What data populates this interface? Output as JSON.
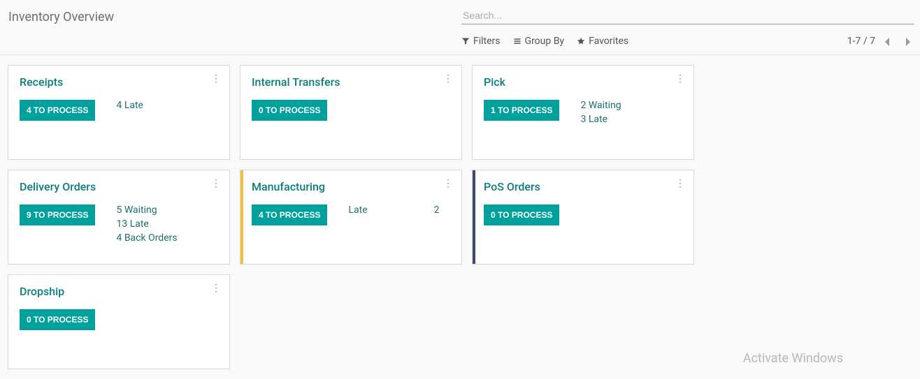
{
  "page": {
    "title": "Inventory Overview"
  },
  "search": {
    "placeholder": "Search..."
  },
  "toolbar": {
    "filters": "Filters",
    "groupby": "Group By",
    "favorites": "Favorites",
    "pager": "1-7 / 7"
  },
  "cards": [
    {
      "title": "Receipts",
      "button": "4 TO PROCESS",
      "statuses": [
        "4 Late"
      ],
      "accent": ""
    },
    {
      "title": "Internal Transfers",
      "button": "0 TO PROCESS",
      "statuses": [],
      "accent": ""
    },
    {
      "title": "Pick",
      "button": "1 TO PROCESS",
      "statuses": [
        "2 Waiting",
        "3 Late"
      ],
      "accent": ""
    },
    {
      "title": "Delivery Orders",
      "button": "9 TO PROCESS",
      "statuses": [
        "5 Waiting",
        "13 Late",
        "4 Back Orders"
      ],
      "accent": ""
    },
    {
      "title": "Manufacturing",
      "button": "4 TO PROCESS",
      "split": {
        "label": "Late",
        "count": "2"
      },
      "accent": "accent-yellow"
    },
    {
      "title": "PoS Orders",
      "button": "0 TO PROCESS",
      "statuses": [],
      "accent": "accent-navy"
    },
    {
      "title": "Dropship",
      "button": "0 TO PROCESS",
      "statuses": [],
      "accent": ""
    }
  ],
  "watermark": "Activate Windows"
}
